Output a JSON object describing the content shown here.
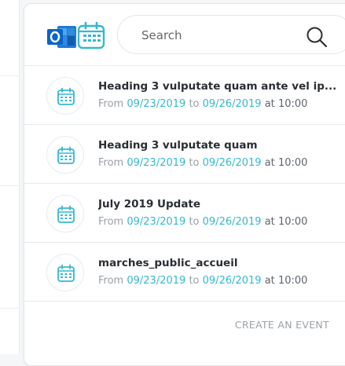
{
  "search": {
    "placeholder": "Search"
  },
  "events": [
    {
      "title": "Heading 3 vulputate quam ante vel ip...",
      "from_label": "From",
      "start": "09/23/2019",
      "to_label": "to",
      "end": "09/26/2019",
      "at_label": "at",
      "time": "10:00"
    },
    {
      "title": "Heading 3 vulputate quam",
      "from_label": "From",
      "start": "09/23/2019",
      "to_label": "to",
      "end": "09/26/2019",
      "at_label": "at",
      "time": "10:00"
    },
    {
      "title": "July 2019 Update",
      "from_label": "From",
      "start": "09/23/2019",
      "to_label": "to",
      "end": "09/26/2019",
      "at_label": "at",
      "time": "10:00"
    },
    {
      "title": "marches_public_accueil",
      "from_label": "From",
      "start": "09/23/2019",
      "to_label": "to",
      "end": "09/26/2019",
      "at_label": "at",
      "time": "10:00"
    }
  ],
  "create_event_label": "CREATE AN EVENT",
  "colors": {
    "accent": "#37b7cf",
    "outlook_blue": "#0a64c8",
    "muted": "#9aa1a8"
  },
  "icons": {
    "outlook": "outlook-icon",
    "calendar": "calendar-icon",
    "search": "search-icon"
  }
}
